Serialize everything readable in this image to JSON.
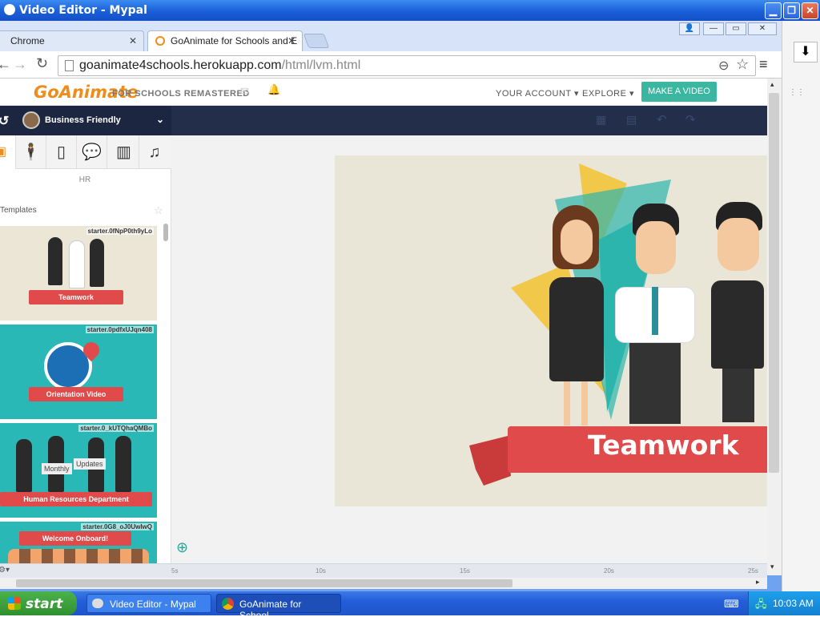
{
  "window": {
    "title": "Video Editor - Mypal"
  },
  "browser": {
    "tabs": [
      {
        "label": "Chrome",
        "active": false
      },
      {
        "label": "GoAnimate for Schools and E",
        "active": true
      }
    ],
    "url": {
      "host": "goanimate4schools.herokuapp.com",
      "path": "/html/lvm.html"
    }
  },
  "site": {
    "logo": "GoAnimate",
    "logo_sub": "FOR SCHOOLS REMASTERED",
    "nav": {
      "account": "YOUR ACCOUNT",
      "explore": "EXPLORE",
      "make_video": "MAKE A VIDEO"
    },
    "theme_label": "Business Friendly"
  },
  "left_panel": {
    "category": "HR",
    "section": "Templates",
    "templates": [
      {
        "code": "starter.0fNpP0th9yLo",
        "title": "Teamwork"
      },
      {
        "code": "starter.0pdfxUJqn408",
        "title": "Orientation Video"
      },
      {
        "code": "starter.0_kUTQhaQMBo",
        "title": "Human Resources Department",
        "tags": [
          "Monthly",
          "Updates"
        ]
      },
      {
        "code": "starter.0G8_oJ0UwlwQ",
        "title": "Welcome Onboard!"
      }
    ]
  },
  "stage": {
    "banner_text": "Teamwork"
  },
  "timeline": {
    "ticks": [
      "5s",
      "10s",
      "15s",
      "20s",
      "25s"
    ]
  },
  "taskbar": {
    "start": "start",
    "tasks": [
      "Video Editor - Mypal",
      "GoAnimate for School..."
    ],
    "clock": "10:03 AM"
  },
  "colors": {
    "accent": "#3bb6a0",
    "dark_nav": "#232e4a",
    "ribbon": "#e04a4a",
    "logo": "#f08c19"
  }
}
